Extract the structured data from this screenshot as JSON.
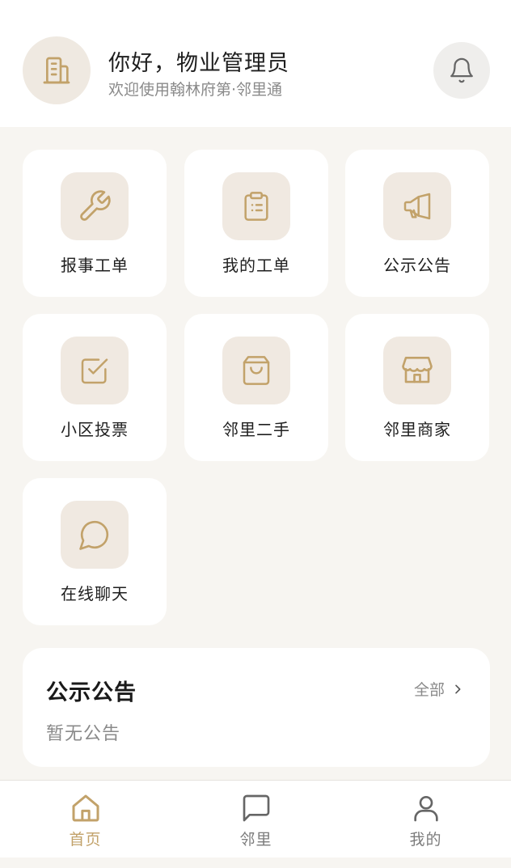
{
  "header": {
    "greeting": "你好，物业管理员",
    "welcome": "欢迎使用翰林府第·邻里通",
    "avatar_icon": "building-icon",
    "bell_icon": "bell-icon"
  },
  "grid": {
    "items": [
      {
        "label": "报事工单",
        "icon": "wrench-icon"
      },
      {
        "label": "我的工单",
        "icon": "clipboard-icon"
      },
      {
        "label": "公示公告",
        "icon": "megaphone-icon"
      },
      {
        "label": "小区投票",
        "icon": "checkbox-icon"
      },
      {
        "label": "邻里二手",
        "icon": "shopping-bag-icon"
      },
      {
        "label": "邻里商家",
        "icon": "store-icon"
      },
      {
        "label": "在线聊天",
        "icon": "chat-bubble-icon"
      }
    ]
  },
  "notice": {
    "title": "公示公告",
    "all_label": "全部",
    "empty_text": "暂无公告"
  },
  "tabbar": {
    "tabs": [
      {
        "label": "首页",
        "icon": "home-icon",
        "active": true
      },
      {
        "label": "邻里",
        "icon": "message-square-icon",
        "active": false
      },
      {
        "label": "我的",
        "icon": "user-icon",
        "active": false
      }
    ]
  },
  "colors": {
    "accent": "#c2a26a",
    "tile_bg": "#f0e9e1",
    "page_bg": "#f7f5f1"
  }
}
